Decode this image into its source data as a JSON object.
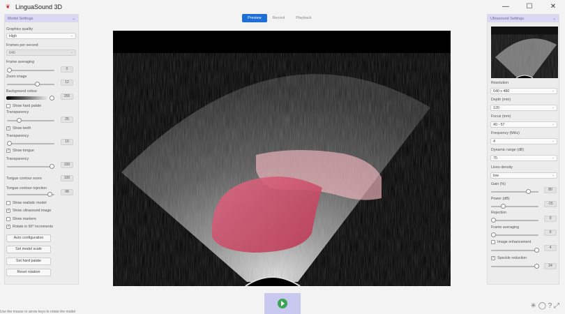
{
  "app": {
    "title": "LinguaSound 3D"
  },
  "window_controls": {
    "minimize": "—",
    "maximize": "☐",
    "close": "✕"
  },
  "tabs": [
    "Preview",
    "Record",
    "Playback"
  ],
  "left": {
    "title": "Model Settings",
    "graphics_quality_label": "Graphics quality",
    "graphics_quality": "High",
    "fps_label": "Frames per second",
    "fps": "640",
    "frame_avg_label": "Frame averaging",
    "frame_avg_value": "0",
    "zoom_label": "Zoom image",
    "zoom_value": "12",
    "bg_label": "Background colour",
    "bg_value": "255",
    "show_hard_palate": "Show hard palate",
    "transparency_label": "Transparency",
    "t1_value": "25",
    "show_teeth": "Show teeth",
    "t2_value": "10",
    "show_tongue": "Show tongue",
    "t3_value": "100",
    "tongue_score_label": "Tongue contour score",
    "tongue_score_value": "100",
    "tongue_reject_label": "Tongue contour rejection",
    "tongue_reject_value": "98",
    "show_realistic": "Show realistic model",
    "show_ultrasound": "Show ultrasound image",
    "show_markers": "Show markers",
    "rotate": "Rotate in 90° increments",
    "btn_auto": "Auto configuration",
    "btn_scale": "Set model scale",
    "btn_palate": "Set hard palate",
    "btn_reset": "Reset rotation"
  },
  "right": {
    "title": "Ultrasound Settings",
    "resolution_label": "Resolution",
    "resolution": "640 x 480",
    "depth_label": "Depth (mm)",
    "depth": "120",
    "focus_label": "Focus (mm)",
    "focus": "40 - 57",
    "freq_label": "Frequency (MHz)",
    "freq": "4",
    "dyn_label": "Dynamic range (dB)",
    "dyn": "75",
    "lines_label": "Lines density",
    "lines": "low",
    "gain_label": "Gain (%)",
    "gain": "80",
    "power_label": "Power (dB)",
    "power": "-15",
    "rejection_label": "Rejection",
    "rejection": "0",
    "frame_avg_label": "Frame averaging",
    "frame_avg": "0",
    "image_enh": "Image enhancement",
    "image_enh_value": "4",
    "speckle": "Speckle reduction",
    "speckle_value": "24"
  },
  "status": {
    "hint": "Use the mouse or arrow keys to rotate the model"
  },
  "corner_icons": "✳ ◯ ? ⤢",
  "colors": {
    "accent": "#1d6fd6",
    "panel_header": "#d9d7f3",
    "tongue": "#d24b6a"
  }
}
